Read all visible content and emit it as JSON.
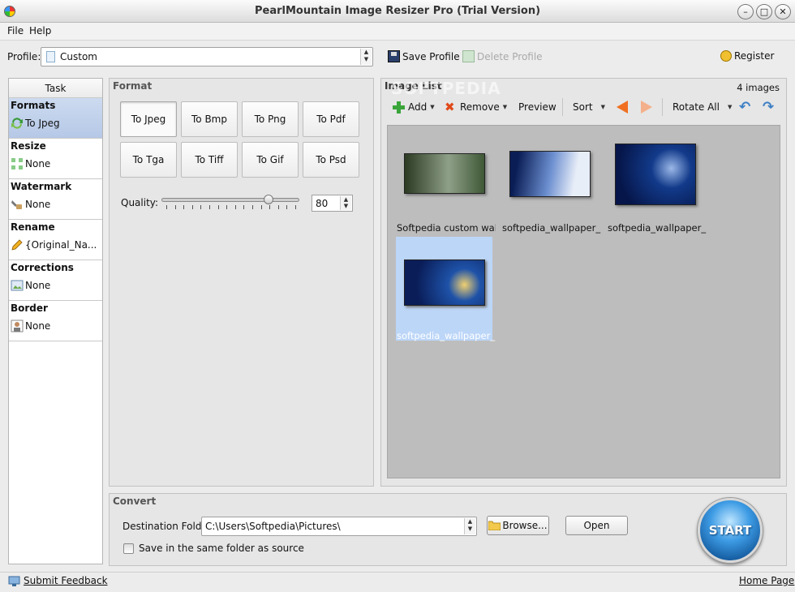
{
  "window": {
    "title": "PearlMountain Image Resizer Pro (Trial Version)"
  },
  "menu": {
    "items": [
      "File",
      "Help"
    ]
  },
  "profile": {
    "label": "Profile:",
    "value": "Custom",
    "save_label": "Save Profile",
    "delete_label": "Delete Profile",
    "register_label": "Register"
  },
  "task": {
    "header": "Task",
    "items": [
      {
        "title": "Formats",
        "value": "To Jpeg",
        "icon": "convert-icon"
      },
      {
        "title": "Resize",
        "value": "None",
        "icon": "resize-icon"
      },
      {
        "title": "Watermark",
        "value": "None",
        "icon": "watermark-icon"
      },
      {
        "title": "Rename",
        "value": "{Original_Na...",
        "icon": "pencil-icon"
      },
      {
        "title": "Corrections",
        "value": "None",
        "icon": "corrections-icon"
      },
      {
        "title": "Border",
        "value": "None",
        "icon": "border-icon"
      }
    ]
  },
  "format": {
    "title": "Format",
    "buttons": [
      "To Jpeg",
      "To Bmp",
      "To Png",
      "To Pdf",
      "To Tga",
      "To Tiff",
      "To Gif",
      "To Psd"
    ],
    "selected": "To Jpeg",
    "quality_label": "Quality:",
    "quality_value": "80"
  },
  "image_list": {
    "title": "Image List",
    "count": "4 images",
    "toolbar": {
      "add": "Add",
      "remove": "Remove",
      "preview": "Preview",
      "sort": "Sort",
      "rotate_all": "Rotate All"
    },
    "images": [
      {
        "name": "Softpedia custom wall...",
        "colors": [
          "#2b3a22",
          "#8fa088",
          "#3f5836"
        ]
      },
      {
        "name": "softpedia_wallpaper_...",
        "colors": [
          "#0a1d55",
          "#6c8fd0",
          "#e8eef8"
        ]
      },
      {
        "name": "softpedia_wallpaper_...",
        "colors": [
          "#06164a",
          "#123a8a",
          "#9bb8e8"
        ]
      },
      {
        "name": "softpedia_wallpaper_...",
        "colors": [
          "#0a1d58",
          "#1e52a8",
          "#f0d070"
        ]
      }
    ],
    "watermark": "SOFTPEDIA"
  },
  "convert": {
    "title": "Convert",
    "dest_label": "Destination Folder:",
    "dest_value": "C:\\Users\\Softpedia\\Pictures\\",
    "browse_label": "Browse...",
    "open_label": "Open",
    "same_folder_label": "Save in the same folder as source",
    "start_label": "START"
  },
  "status": {
    "feedback": "Submit Feedback",
    "home": "Home Page"
  }
}
